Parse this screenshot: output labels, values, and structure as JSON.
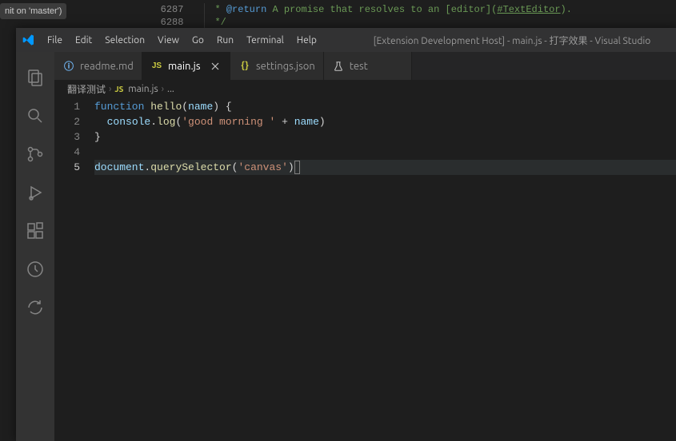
{
  "background": {
    "badge_text": "nit on 'master')",
    "line_nums": [
      "6287",
      "6288"
    ],
    "comment_prefix": "* ",
    "return_tag": "@return",
    "comment_text": " A promise that resolves to an [editor](",
    "link_text": "#TextEditor",
    "comment_suffix": ").",
    "close": "*/"
  },
  "titlebar": {
    "title": "[Extension Development Host] - main.js - 打字效果 - Visual Studio "
  },
  "menu": {
    "items": [
      "File",
      "Edit",
      "Selection",
      "View",
      "Go",
      "Run",
      "Terminal",
      "Help"
    ]
  },
  "tabs": [
    {
      "label": "readme.md",
      "icon": "info",
      "active": false,
      "closable": false
    },
    {
      "label": "main.js",
      "icon": "js",
      "active": true,
      "closable": true
    },
    {
      "label": "settings.json",
      "icon": "json",
      "active": false,
      "closable": false
    },
    {
      "label": "test",
      "icon": "test",
      "active": false,
      "closable": false
    }
  ],
  "breadcrumb": {
    "folder": "翻译测试",
    "file": "main.js",
    "ellipsis": "..."
  },
  "code": {
    "lines": [
      {
        "n": 1,
        "tokens": [
          {
            "t": "function",
            "c": "kw"
          },
          {
            "t": " ",
            "c": "pn"
          },
          {
            "t": "hello",
            "c": "fn"
          },
          {
            "t": "(",
            "c": "pn"
          },
          {
            "t": "name",
            "c": "param"
          },
          {
            "t": ") {",
            "c": "pn"
          }
        ]
      },
      {
        "n": 2,
        "tokens": [
          {
            "t": "  ",
            "c": "pn"
          },
          {
            "t": "console",
            "c": "obj"
          },
          {
            "t": ".",
            "c": "pn"
          },
          {
            "t": "log",
            "c": "fn"
          },
          {
            "t": "(",
            "c": "pn"
          },
          {
            "t": "'good morning '",
            "c": "str"
          },
          {
            "t": " + ",
            "c": "op"
          },
          {
            "t": "name",
            "c": "param"
          },
          {
            "t": ")",
            "c": "pn"
          }
        ]
      },
      {
        "n": 3,
        "tokens": [
          {
            "t": "}",
            "c": "pn"
          }
        ]
      },
      {
        "n": 4,
        "tokens": []
      },
      {
        "n": 5,
        "current": true,
        "tokens": [
          {
            "t": "document",
            "c": "obj"
          },
          {
            "t": ".",
            "c": "pn"
          },
          {
            "t": "querySelector",
            "c": "fn"
          },
          {
            "t": "(",
            "c": "pn"
          },
          {
            "t": "'canvas'",
            "c": "str"
          },
          {
            "t": ")",
            "c": "pn"
          }
        ],
        "cursor_after": true
      }
    ]
  }
}
